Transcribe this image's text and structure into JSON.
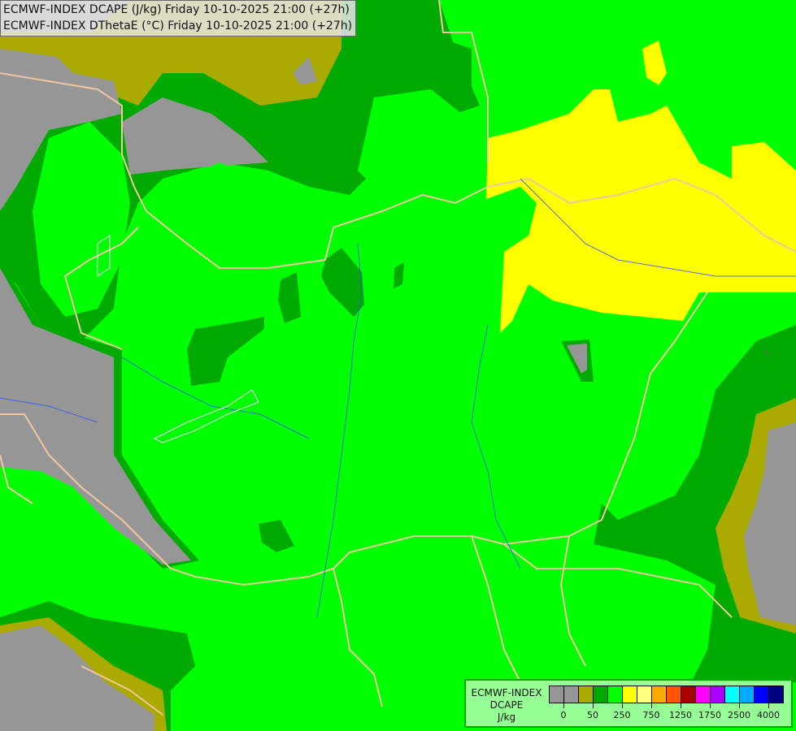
{
  "header": {
    "line1": "ECMWF-INDEX DCAPE (J/kg) Friday 10-10-2025 21:00 (+27h)",
    "line2": "ECMWF-INDEX DThetaE (°C) Friday 10-10-2025 21:00 (+27h)"
  },
  "legend": {
    "title1": "ECMWF-INDEX",
    "title2": "DCAPE",
    "unit": "J/kg",
    "colors": [
      "#969696",
      "#969696",
      "#aaaa00",
      "#00aa00",
      "#00ff00",
      "#ffff00",
      "#ffff80",
      "#ffaa00",
      "#ff5500",
      "#aa0000",
      "#ff00ff",
      "#aa00ff",
      "#00ffff",
      "#00aaff",
      "#0000ff",
      "#000080"
    ],
    "labels": [
      "0",
      "50",
      "250",
      "750",
      "1250",
      "1750",
      "2500",
      "4000"
    ]
  },
  "map": {
    "colors": {
      "grey": "#969696",
      "olive": "#aaaa00",
      "dark_green": "#00aa00",
      "green": "#00ff00",
      "yellow": "#ffff00",
      "border": "#f0c8a0",
      "river": "#3050ff"
    },
    "contour_label": "5"
  }
}
